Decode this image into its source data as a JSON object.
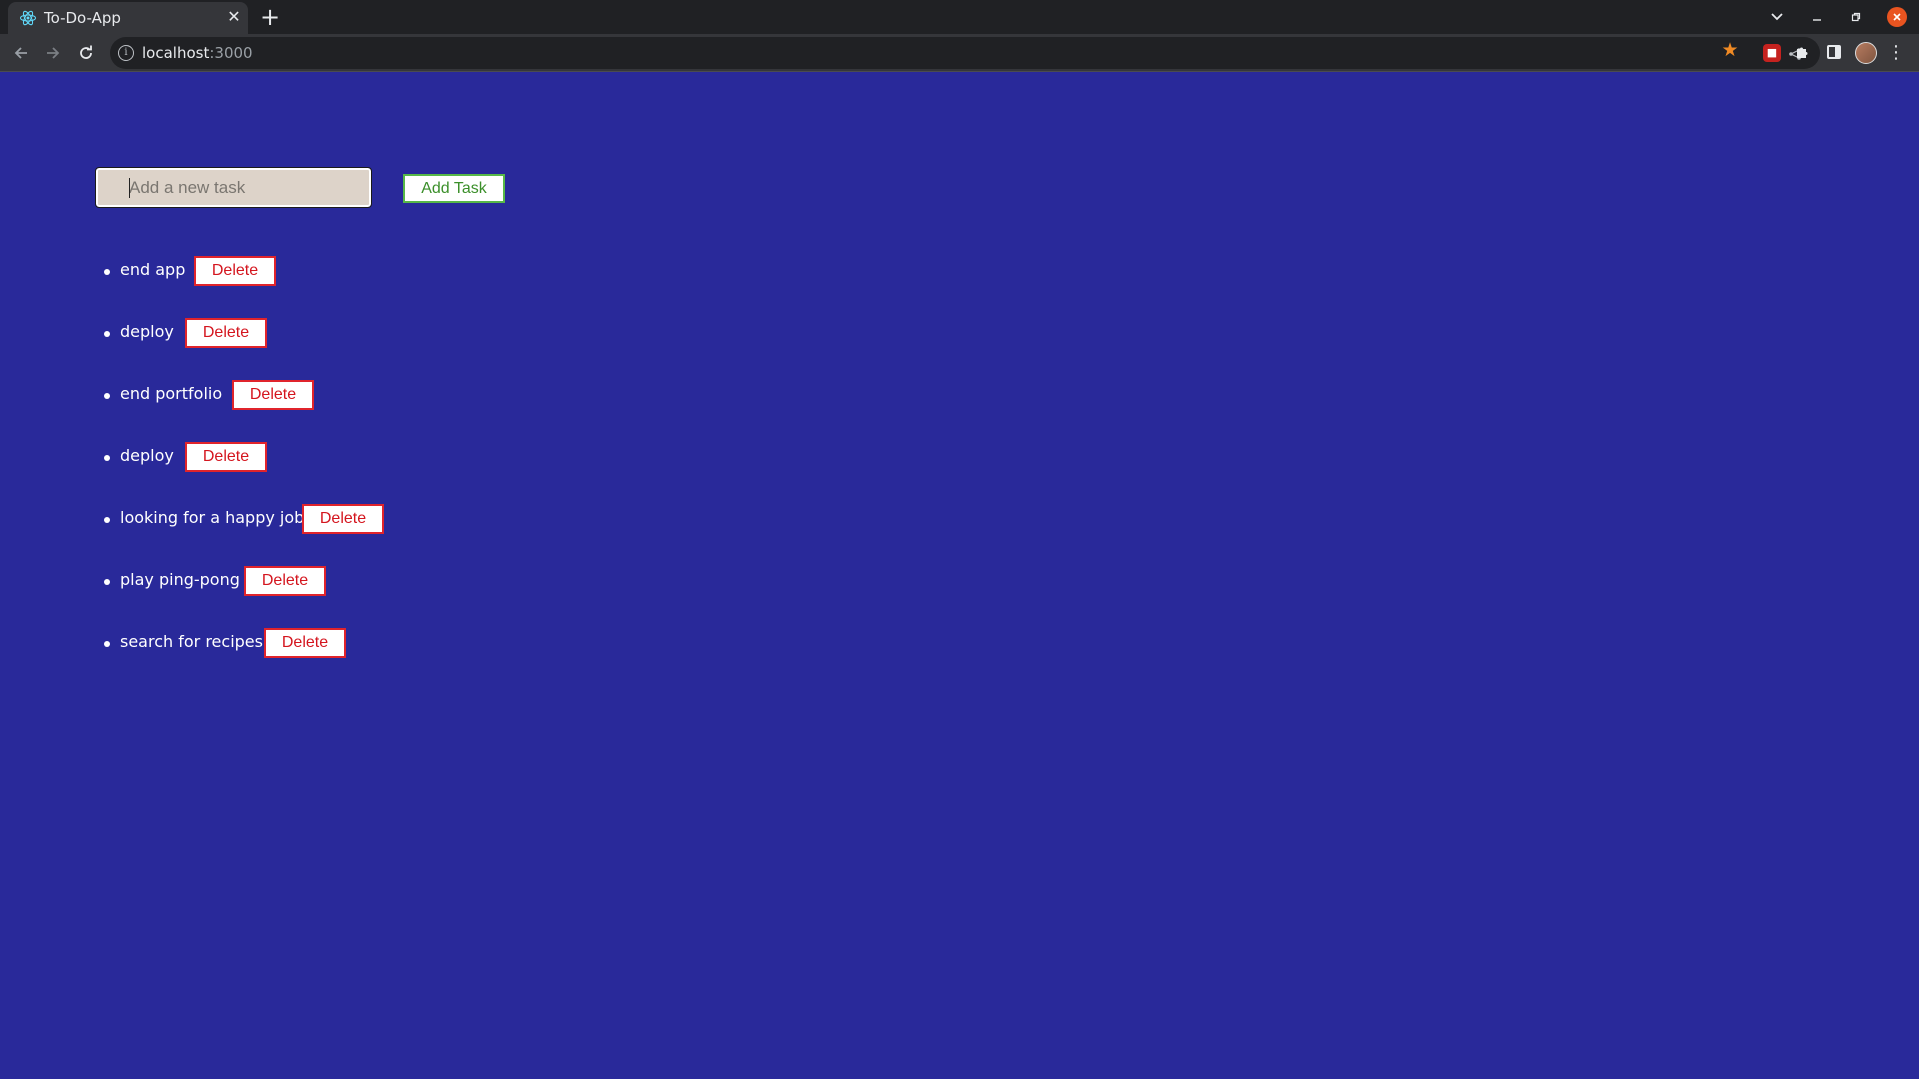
{
  "browser": {
    "tab_title": "To-Do-App",
    "tab_close": "✕",
    "new_tab": "+",
    "url_host": "localhost",
    "url_port": ":3000",
    "icons": {
      "favicon": "react-logo-icon",
      "back": "arrow-left-icon",
      "forward": "arrow-right-icon",
      "reload": "reload-icon",
      "info": "info-icon",
      "share": "share-icon",
      "bookmark": "star-icon",
      "extensions": "puzzle-icon",
      "side_panel": "side-panel-icon",
      "menu": "kebab-menu-icon"
    }
  },
  "app": {
    "input_placeholder": "Add a new task",
    "input_value": "",
    "add_button_label": "Add Task",
    "tasks": [
      {
        "text": "end app",
        "delete_label": "Delete"
      },
      {
        "text": "deploy",
        "delete_label": "Delete"
      },
      {
        "text": "end portfolio",
        "delete_label": "Delete"
      },
      {
        "text": "deploy",
        "delete_label": "Delete"
      },
      {
        "text": "looking for a happy job",
        "delete_label": "Delete"
      },
      {
        "text": "play ping-pong",
        "delete_label": "Delete"
      },
      {
        "text": "search for recipes",
        "delete_label": "Delete"
      }
    ]
  },
  "colors": {
    "page_background": "#29299a",
    "input_background": "#ddd3c9",
    "add_button_border": "#57b848",
    "delete_button_border": "#e0242c",
    "delete_button_text": "#d4151e"
  }
}
